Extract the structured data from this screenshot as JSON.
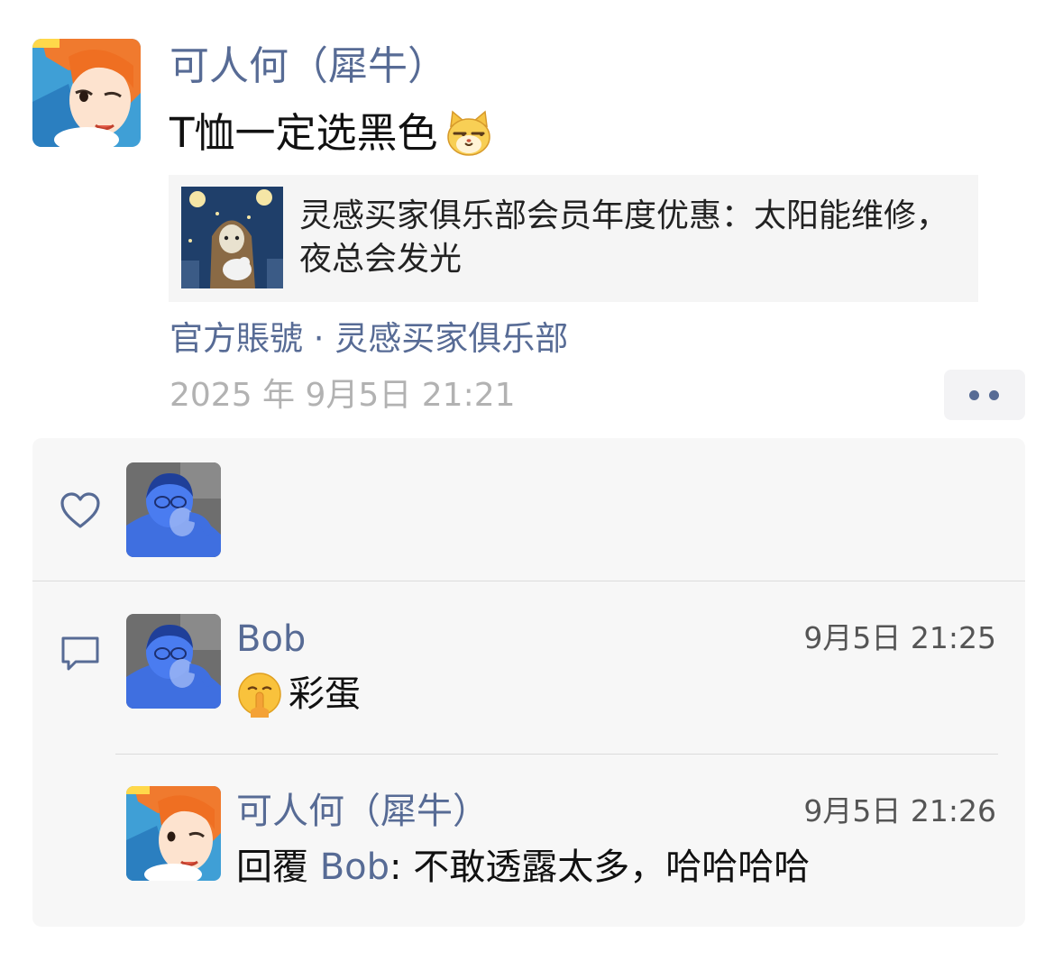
{
  "post": {
    "author": "可人何（犀牛）",
    "text": "T恤一定选黑色",
    "text_emoji": "cat-smirk-emoji",
    "link_card": {
      "title": "灵感买家俱乐部会员年度优惠：太阳能维修，夜总会发光"
    },
    "source": "官方賬號 · 灵感买家俱乐部",
    "timestamp": "2025 年 9月5日 21:21"
  },
  "interactions": {
    "comments": [
      {
        "author": "Bob",
        "time": "9月5日 21:25",
        "text": "彩蛋",
        "emoji": "shushing-face-emoji"
      },
      {
        "author": "可人何（犀牛）",
        "time": "9月5日 21:26",
        "reply_prefix": "回覆 ",
        "reply_to": "Bob",
        "text": ": 不敢透露太多，哈哈哈哈"
      }
    ]
  },
  "colors": {
    "link_blue": "#576b95",
    "timestamp_gray": "#b2b2b2",
    "panel_bg": "#f7f7f7",
    "card_bg": "#f5f5f5"
  }
}
